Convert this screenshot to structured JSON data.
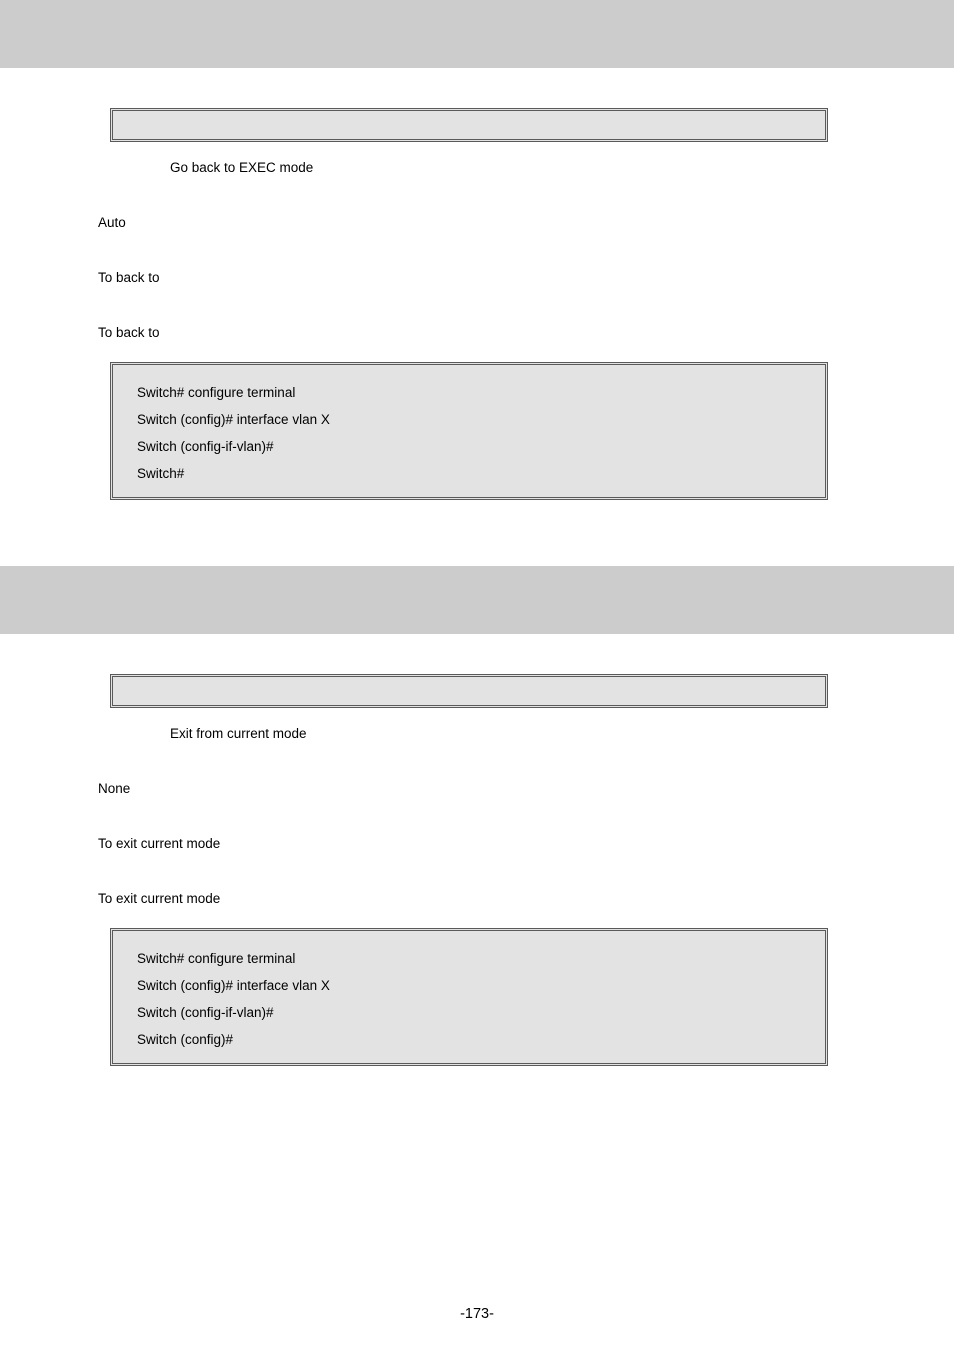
{
  "section1": {
    "syntax_desc": "Go back to EXEC mode",
    "default": "Auto",
    "usage": "To back to",
    "example_intro": "To back to",
    "code": [
      "Switch# configure terminal",
      "Switch (config)# interface vlan X",
      "Switch (config-if-vlan)#",
      "Switch#"
    ]
  },
  "section2": {
    "syntax_desc": "Exit from current mode",
    "default": "None",
    "usage": "To exit current mode",
    "example_intro": "To exit current mode",
    "code": [
      "Switch# configure terminal",
      "Switch (config)# interface vlan X",
      "Switch (config-if-vlan)#",
      "Switch (config)#"
    ]
  },
  "footer": "-173-"
}
